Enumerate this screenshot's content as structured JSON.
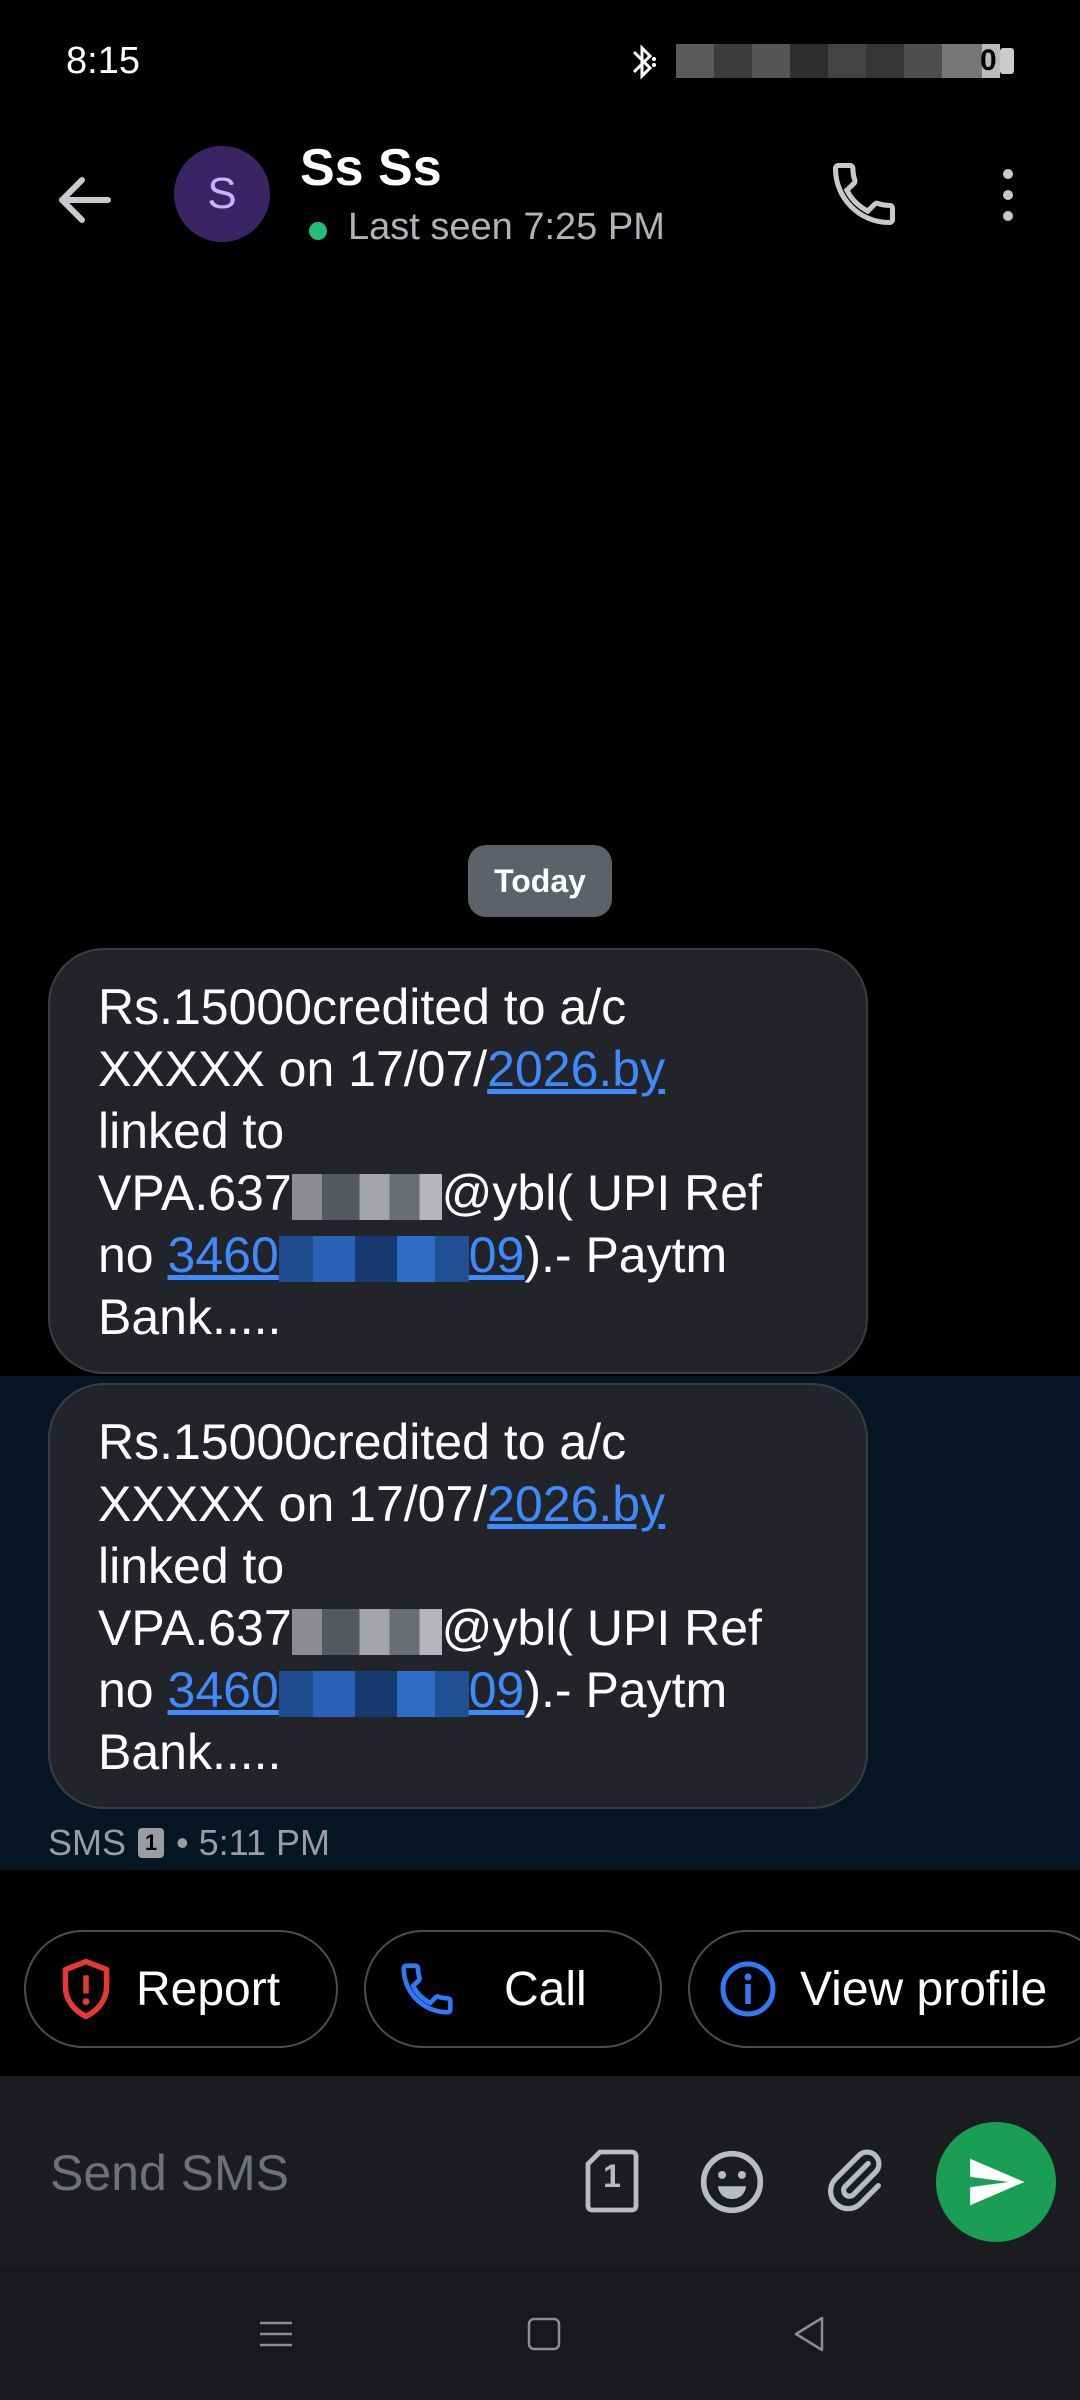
{
  "status_bar": {
    "time": "8:15",
    "battery_label": "0"
  },
  "header": {
    "avatar_letter": "S",
    "contact_name": "Ss Ss",
    "last_seen": "Last seen 7:25 PM"
  },
  "thread": {
    "date_chip": "Today",
    "messages": [
      {
        "l1": "Rs.15000credited to a/c",
        "l2_pre": "XXXXX on 17/07/",
        "l2_link": "2026.by",
        "l3": "linked to",
        "l4_pre": "VPA.637",
        "l4_post": "@ybl( UPI Ref",
        "l5_pre": "no ",
        "l5_link_a": "3460",
        "l5_link_b": "09",
        "l5_post": ").- Paytm",
        "l6": "Bank....."
      },
      {
        "l1": "Rs.15000credited to a/c",
        "l2_pre": "XXXXX on 17/07/",
        "l2_link": "2026.by",
        "l3": "linked to",
        "l4_pre": "VPA.637",
        "l4_post": "@ybl( UPI Ref",
        "l5_pre": "no ",
        "l5_link_a": "3460",
        "l5_link_b": "09",
        "l5_post": ").- Paytm",
        "l6": "Bank....."
      }
    ],
    "meta_type": "SMS",
    "meta_sim": "1",
    "meta_time": "• 5:11 PM"
  },
  "suggestions": {
    "report": "Report",
    "call": "Call",
    "view_profile": "View profile"
  },
  "compose": {
    "placeholder": "Send SMS",
    "sim_slot": "1"
  },
  "colors": {
    "background": "#000000",
    "bubble": "#222429",
    "link": "#3d8bff",
    "send": "#1a9e55",
    "report_icon": "#e53935",
    "action_blue": "#2f7bf5",
    "online": "#1fbf7a"
  },
  "icons": [
    "bluetooth-icon",
    "back-arrow-icon",
    "phone-icon",
    "more-vert-icon",
    "shield-alert-icon",
    "info-icon",
    "sim-icon",
    "emoji-icon",
    "attach-icon",
    "send-icon",
    "nav-menu-icon",
    "nav-home-icon",
    "nav-back-icon"
  ]
}
